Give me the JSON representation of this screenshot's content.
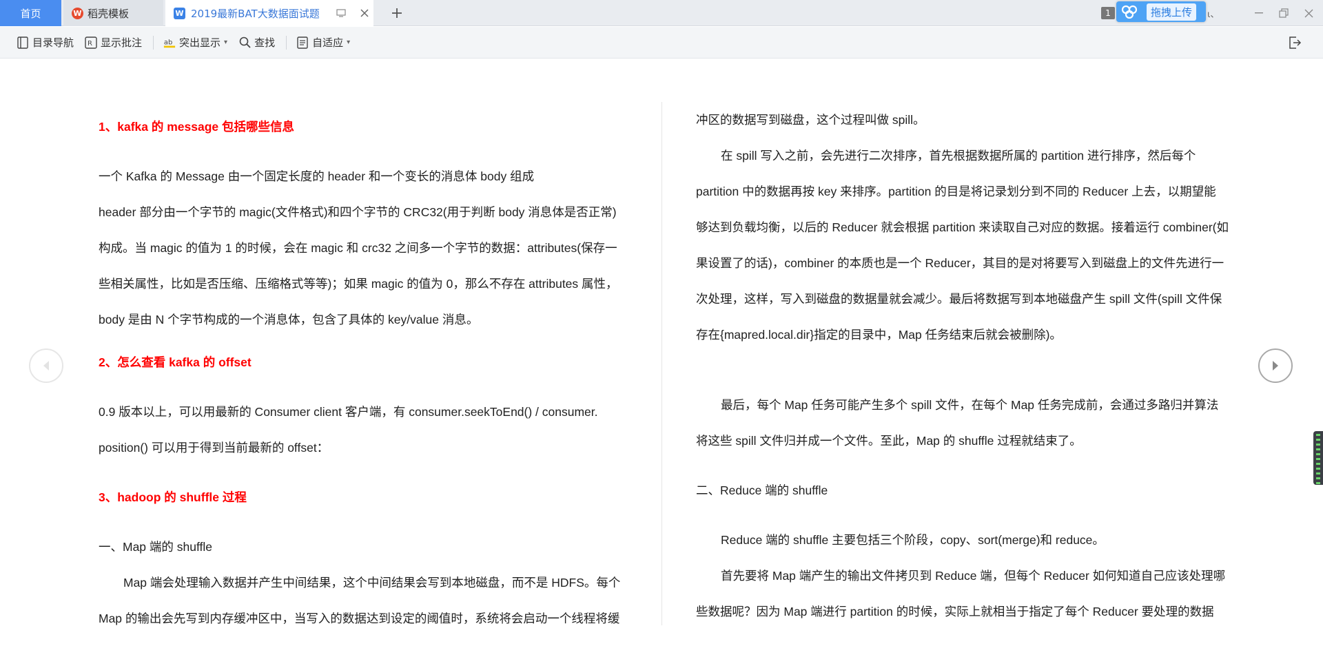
{
  "tabs": {
    "home": "首页",
    "template": "稻壳模板",
    "document": "2019最新BAT大数据面试题"
  },
  "titlebar": {
    "page_badge": "1",
    "upload_label": "拖拽上传",
    "upload_tail": "ι、"
  },
  "toolbar": {
    "toc": "目录导航",
    "annotations": "显示批注",
    "highlight": "突出显示",
    "find": "查找",
    "fit": "自适应"
  },
  "left_column": {
    "heading1": "1、kafka 的 message 包括哪些信息",
    "p1": "一个 Kafka 的 Message 由一个固定长度的 header 和一个变长的消息体 body 组成",
    "p2": "header 部分由一个字节的 magic(文件格式)和四个字节的 CRC32(用于判断 body 消息体是否正常)",
    "p3": "构成。当 magic 的值为 1 的时候，会在 magic 和 crc32 之间多一个字节的数据：attributes(保存一",
    "p4": "些相关属性，比如是否压缩、压缩格式等等)；如果 magic 的值为 0，那么不存在 attributes 属性，",
    "p5": "body 是由 N 个字节构成的一个消息体，包含了具体的 key/value 消息。",
    "heading2": "2、怎么查看 kafka 的 offset",
    "p6": "0.9 版本以上，可以用最新的 Consumer client 客户端，有 consumer.seekToEnd() / consumer.",
    "p7": "position() 可以用于得到当前最新的 offset：",
    "heading3": "3、hadoop 的 shuffle 过程",
    "p8": "一、Map 端的 shuffle",
    "p9": "Map 端会处理输入数据并产生中间结果，这个中间结果会写到本地磁盘，而不是 HDFS。每个",
    "p10": "Map 的输出会先写到内存缓冲区中，当写入的数据达到设定的阈值时，系统将会启动一个线程将缓"
  },
  "right_column": {
    "r1": "冲区的数据写到磁盘，这个过程叫做 spill。",
    "r2": "在 spill 写入之前，会先进行二次排序，首先根据数据所属的 partition 进行排序，然后每个",
    "r3": "partition 中的数据再按 key 来排序。partition 的目是将记录划分到不同的 Reducer 上去，以期望能",
    "r4": "够达到负载均衡，以后的 Reducer 就会根据 partition 来读取自己对应的数据。接着运行 combiner(如",
    "r5": "果设置了的话)，combiner 的本质也是一个 Reducer，其目的是对将要写入到磁盘上的文件先进行一",
    "r6": "次处理，这样，写入到磁盘的数据量就会减少。最后将数据写到本地磁盘产生 spill 文件(spill 文件保",
    "r7": "存在{mapred.local.dir}指定的目录中，Map 任务结束后就会被删除)。",
    "r8": "最后，每个 Map 任务可能产生多个 spill 文件，在每个 Map 任务完成前，会通过多路归并算法",
    "r9": "将这些 spill 文件归并成一个文件。至此，Map 的 shuffle 过程就结束了。",
    "r10": "二、Reduce 端的 shuffle",
    "r11": "Reduce 端的 shuffle 主要包括三个阶段，copy、sort(merge)和 reduce。",
    "r12": "首先要将 Map 端产生的输出文件拷贝到 Reduce 端，但每个 Reducer 如何知道自己应该处理哪",
    "r13": "些数据呢？因为 Map 端进行 partition 的时候，实际上就相当于指定了每个 Reducer 要处理的数据"
  },
  "colors": {
    "heading": "#ff0000",
    "home_tab": "#4a8df0",
    "upload": "#4ea3f5",
    "doc_tab_text": "#3a78d8"
  },
  "icons": {
    "template_tab": "wps-logo-icon",
    "document_tab": "word-doc-icon",
    "upload": "baidu-cloud-icon"
  }
}
